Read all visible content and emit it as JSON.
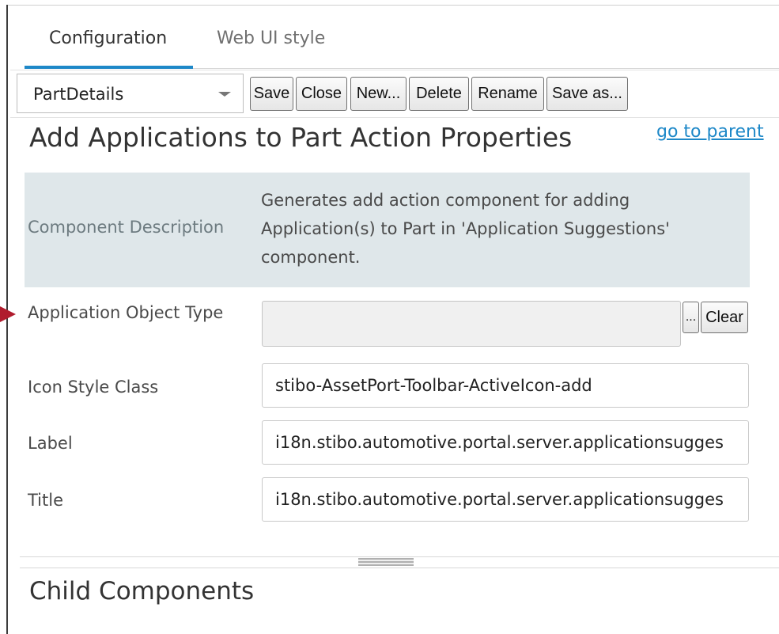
{
  "tabs": [
    {
      "label": "Configuration",
      "active": true
    },
    {
      "label": "Web UI style",
      "active": false
    }
  ],
  "toolbar": {
    "selected_component": "PartDetails",
    "buttons": {
      "save": "Save",
      "close": "Close",
      "new": "New...",
      "delete": "Delete",
      "rename": "Rename",
      "save_as": "Save as..."
    }
  },
  "heading": "Add Applications to Part Action Properties",
  "go_to_parent": "go to parent",
  "description": {
    "label": "Component Description",
    "text": "Generates add action component for adding Application(s) to Part in 'Application Suggestions' component."
  },
  "fields": {
    "application_object_type": {
      "label": "Application Object Type",
      "value": "",
      "browse_label": "...",
      "clear_label": "Clear"
    },
    "icon_style_class": {
      "label": "Icon Style Class",
      "value": "stibo-AssetPort-Toolbar-ActiveIcon-add"
    },
    "label": {
      "label": "Label",
      "value": "i18n.stibo.automotive.portal.server.applicationsugges"
    },
    "title": {
      "label": "Title",
      "value": "i18n.stibo.automotive.portal.server.applicationsugges"
    }
  },
  "child_components_heading": "Child Components",
  "colors": {
    "accent": "#1e88c8",
    "description_bg": "#dfe7ea",
    "marker": "#b01c2e"
  },
  "icons": {
    "dropdown": "chevron-down-icon",
    "field_marker": "arrow-right-icon"
  }
}
